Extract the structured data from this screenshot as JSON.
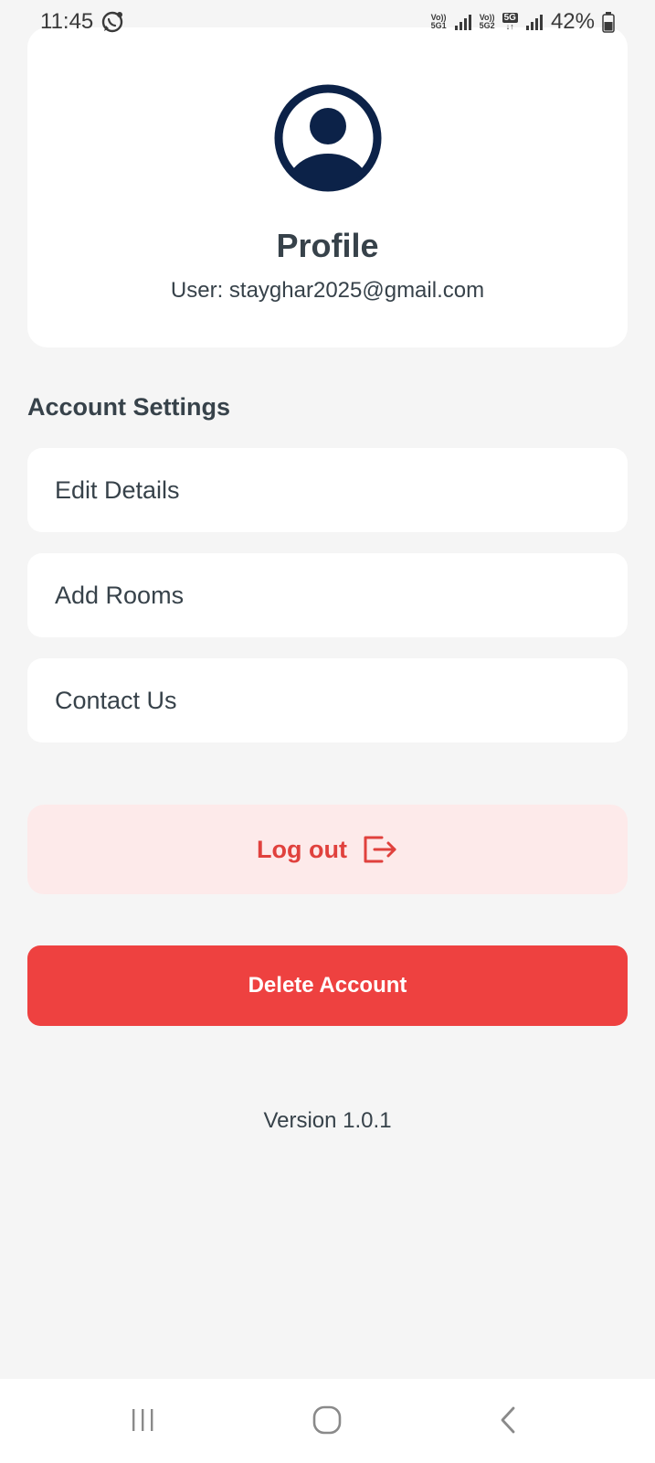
{
  "status_bar": {
    "time": "11:45",
    "sim1_top": "Vo))",
    "sim1_bottom": "5G1",
    "sim2_top": "Vo))",
    "sim2_bottom": "5G2",
    "network_badge": "5G",
    "battery": "42%"
  },
  "profile": {
    "title": "Profile",
    "user": "User: stayghar2025@gmail.com"
  },
  "account_settings": {
    "heading": "Account Settings",
    "items": [
      {
        "label": "Edit Details"
      },
      {
        "label": "Add Rooms"
      },
      {
        "label": "Contact Us"
      }
    ]
  },
  "actions": {
    "logout_label": "Log out",
    "delete_label": "Delete Account"
  },
  "footer": {
    "version": "Version 1.0.1"
  },
  "colors": {
    "background": "#f5f5f5",
    "card": "#ffffff",
    "text": "#37424a",
    "avatar": "#0c2248",
    "logout_bg": "#fdeaea",
    "logout_text": "#e0413d",
    "delete_bg": "#ee4140"
  },
  "icons": {
    "status": [
      "whatsapp-icon",
      "signal-icon",
      "battery-icon"
    ],
    "avatar": "user-circle-icon",
    "logout": "logout-arrow-icon",
    "nav": [
      "recent-apps-icon",
      "home-icon",
      "back-icon"
    ]
  }
}
